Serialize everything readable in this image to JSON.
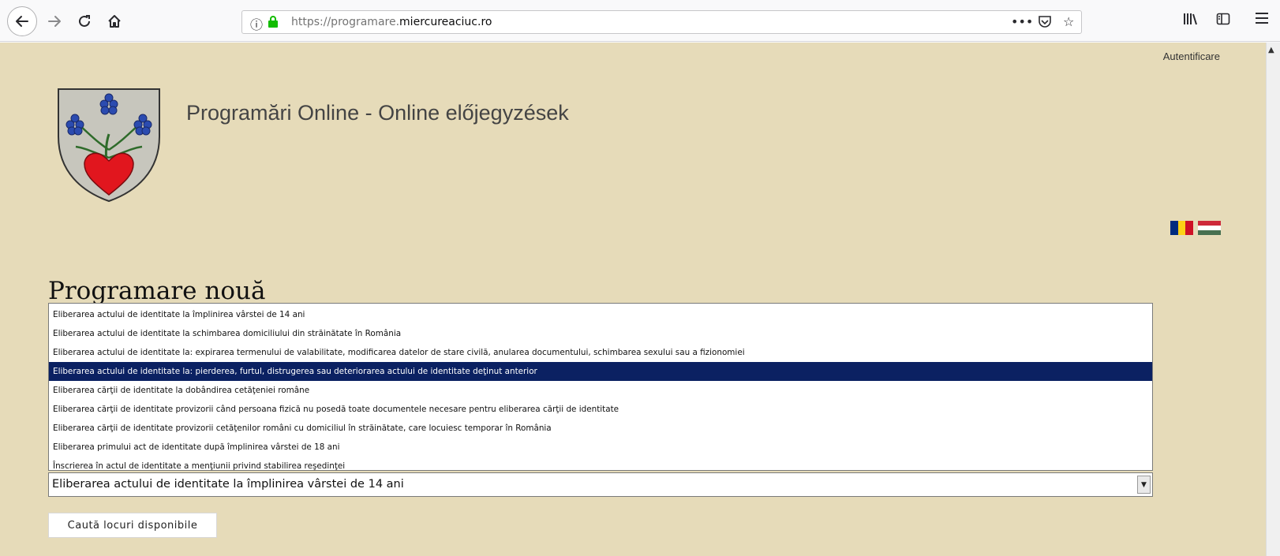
{
  "browser": {
    "url_prefix": "https://programare.",
    "url_domain": "miercureaciuc.ro",
    "icons": [
      "back-arrow-icon",
      "forward-arrow-icon",
      "reload-icon",
      "home-icon",
      "info-icon",
      "lock-icon",
      "more-icon",
      "pocket-icon",
      "bookmark-star-icon",
      "library-icon",
      "sidebar-icon",
      "menu-icon"
    ]
  },
  "page": {
    "login_link": "Autentificare",
    "site_title": "Programări Online - Online előjegyzések",
    "section_title": "Programare nouă",
    "colors": {
      "background": "#e6dbb9",
      "selected_option": "#0b2162"
    },
    "languages": [
      "ro-flag-icon",
      "hu-flag-icon"
    ]
  },
  "service_select": {
    "selected_value": "Eliberarea actului de identitate la împlinirea vârstei de 14 ani",
    "options": [
      "Eliberarea actului de identitate la împlinirea vârstei de 14 ani",
      "Eliberarea actului de identitate la schimbarea domiciliului din străinătate în România",
      "Eliberarea actului de identitate la: expirarea termenului de valabilitate, modificarea datelor de stare civilă, anularea documentului, schimbarea sexului sau a fizionomiei",
      "Eliberarea actului de identitate la: pierderea, furtul, distrugerea sau deteriorarea actului de identitate deţinut anterior",
      "Eliberarea cărţii de identitate la dobândirea cetăţeniei române",
      "Eliberarea cărţii de identitate provizorii când persoana fizică nu posedă toate documentele necesare pentru eliberarea cărţii de identitate",
      "Eliberarea cărţii de identitate provizorii cetăţenilor români cu domiciliul în străinătate, care locuiesc temporar în România",
      "Eliberarea primului act de identitate după împlinirea vârstei de 18 ani",
      "Înscrierea în actul de identitate a menţiunii privind stabilirea reşedinţei"
    ],
    "highlighted_index": 3
  },
  "search_button_label": "Caută locuri disponibile"
}
